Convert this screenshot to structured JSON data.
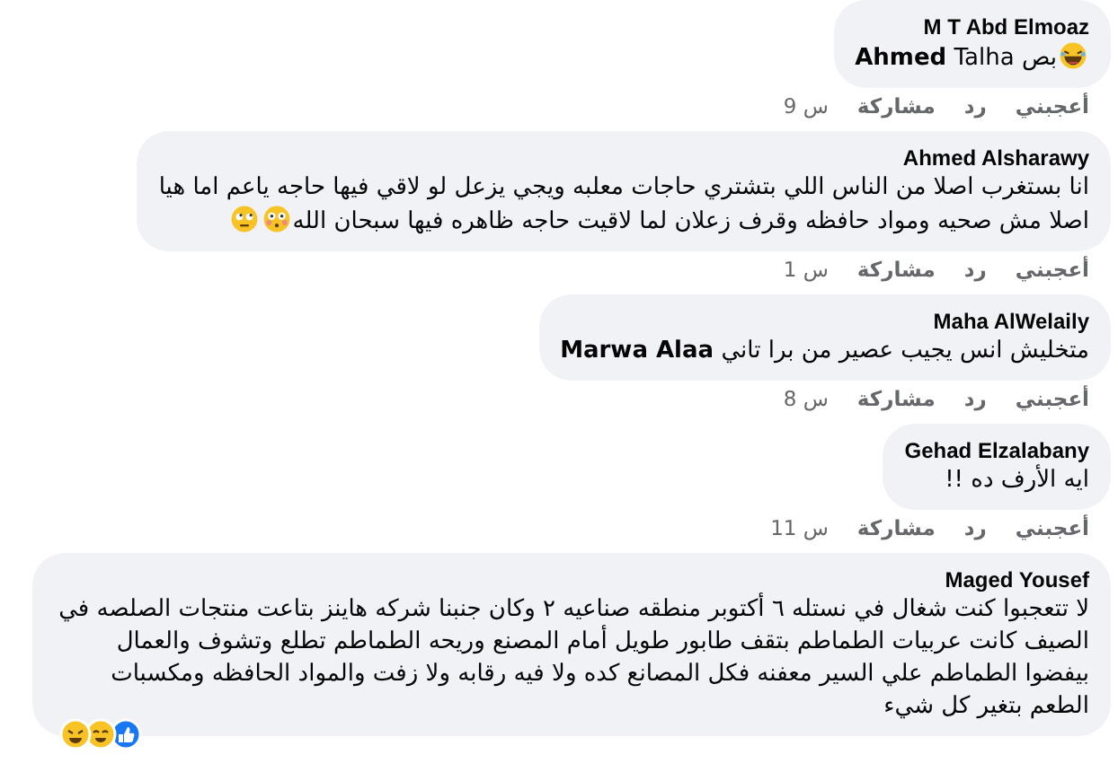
{
  "comments": [
    {
      "author": "M T Abd Elmoaz",
      "body": [
        {
          "kind": "laughing"
        },
        {
          "kind": "text",
          "text": "بص **Ahmed** Talha"
        }
      ],
      "actions": {
        "like": "أعجبني",
        "reply": "رد",
        "share": "مشاركة",
        "time": "9 س"
      }
    },
    {
      "author": "Ahmed Alsharawy",
      "body": [
        {
          "kind": "text",
          "text": "انا بستغرب اصلا من الناس اللي بتشتري حاجات معلبه ويجي يزعل لو لاقي فيها حاجه ياعم اما هيا"
        },
        {
          "kind": "text",
          "text": "اصلا مش صحيه ومواد حافظه وقرف زعلان لما لاقيت حاجه ظاهره فيها سبحان الله"
        },
        {
          "kind": "flushed"
        },
        {
          "kind": "eyeroll"
        }
      ],
      "actions": {
        "like": "أعجبني",
        "reply": "رد",
        "share": "مشاركة",
        "time": "1 س"
      }
    },
    {
      "author": "Maha AlWelaily",
      "body": [
        {
          "kind": "text",
          "text": "متخليش انس يجيب عصير من برا تاني **Marwa Alaa**"
        }
      ],
      "actions": {
        "like": "أعجبني",
        "reply": "رد",
        "share": "مشاركة",
        "time": "8 س"
      }
    },
    {
      "author": "Gehad Elzalabany",
      "body": [
        {
          "kind": "text",
          "text": "ايه الأرف ده !!"
        }
      ],
      "actions": {
        "like": "أعجبني",
        "reply": "رد",
        "share": "مشاركة",
        "time": "11 س"
      }
    },
    {
      "author": "Maged Yousef",
      "body": [
        {
          "kind": "text",
          "text": "لا تتعجبوا كنت شغال في نستله ٦ أكتوبر منطقه صناعيه ٢ وكان جنبنا شركه هاينز بتاعت منتجات الصلصه في الصيف كانت عربيات الطماطم بتقف طابور طويل أمام المصنع وريحه الطماطم تطلع وتشوف والعمال بيفضوا الطماطم علي السير معفنه فكل المصانع كده ولا فيه رقابه ولا زفت والمواد الحافظه ومكسبات الطعم بتغير كل شيء"
        }
      ],
      "reactions": true
    }
  ]
}
